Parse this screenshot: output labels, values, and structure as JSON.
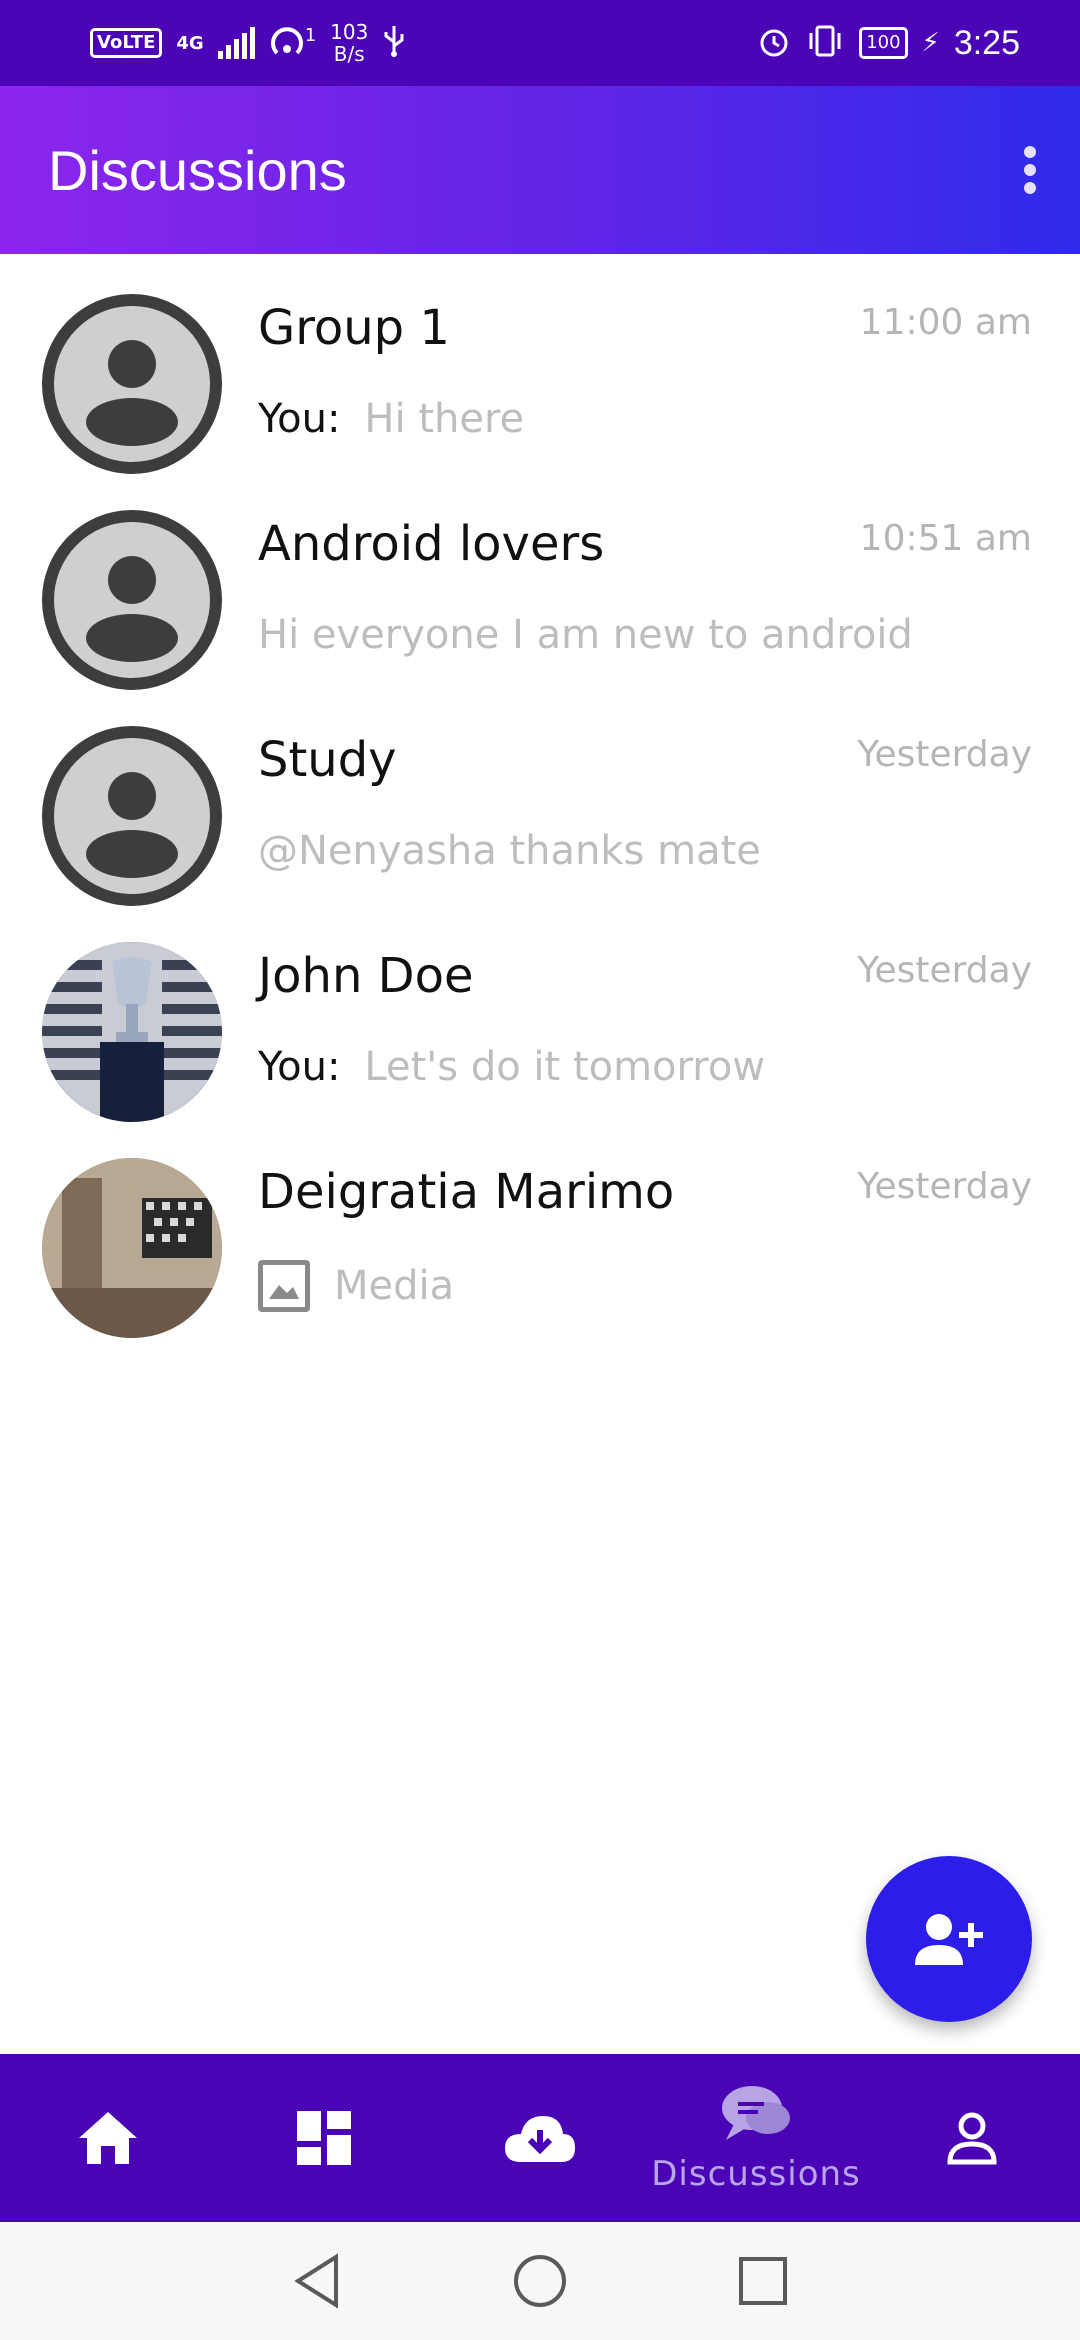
{
  "status_bar": {
    "volte": "VoLTE",
    "network_type": "4G",
    "hotspot_superscript": "1",
    "net_speed_value": "103",
    "net_speed_unit": "B/s",
    "battery": "100",
    "time": "3:25"
  },
  "app_bar": {
    "title": "Discussions"
  },
  "chats": [
    {
      "name": "Group 1",
      "time": "11:00 am",
      "you_prefix": "You:",
      "preview": "Hi there"
    },
    {
      "name": "Android lovers",
      "time": "10:51 am",
      "preview": "Hi everyone I am new to android"
    },
    {
      "name": "Study",
      "time": "Yesterday",
      "preview": "@Nenyasha thanks mate"
    },
    {
      "name": "John Doe",
      "time": "Yesterday",
      "you_prefix": "You:",
      "preview": "Let's do it tomorrow"
    },
    {
      "name": "Deigratia Marimo",
      "time": "Yesterday",
      "preview": "Media"
    }
  ],
  "fab": {
    "icon": "add-person-icon"
  },
  "bottom_nav": {
    "items": [
      {
        "icon": "home-icon"
      },
      {
        "icon": "dashboard-icon"
      },
      {
        "icon": "cloud-download-icon"
      },
      {
        "icon": "discussions-icon",
        "label": "Discussions",
        "active": true
      },
      {
        "icon": "profile-icon"
      }
    ]
  },
  "colors": {
    "status_bar": "#4b04b6",
    "app_bar_start": "#8c25ec",
    "app_bar_end": "#2f2bea",
    "fab": "#2d1de8",
    "bottom_nav": "#4a04b6"
  }
}
